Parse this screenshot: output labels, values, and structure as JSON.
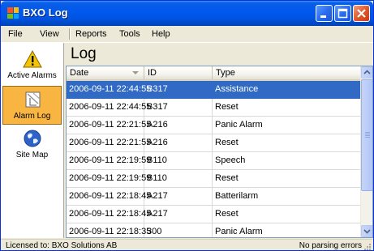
{
  "window": {
    "title": "BXO Log"
  },
  "menu": {
    "items": [
      {
        "label": "File"
      },
      {
        "label": "View"
      },
      {
        "label": "Reports"
      },
      {
        "label": "Tools"
      },
      {
        "label": "Help"
      }
    ]
  },
  "sidebar": {
    "items": [
      {
        "label": "Active Alarms",
        "icon": "warning-icon",
        "selected": false
      },
      {
        "label": "Alarm Log",
        "icon": "log-icon",
        "selected": true
      },
      {
        "label": "Site Map",
        "icon": "globe-icon",
        "selected": false
      }
    ]
  },
  "main": {
    "title": "Log"
  },
  "table": {
    "columns": [
      "Date",
      "ID",
      "Type"
    ],
    "rows": [
      {
        "date": "2006-09-11 22:44:55",
        "id": "B317",
        "type": "Assistance",
        "selected": true
      },
      {
        "date": "2006-09-11 22:44:55",
        "id": "B317",
        "type": "Reset"
      },
      {
        "date": "2006-09-11 22:21:55",
        "id": "A216",
        "type": "Panic Alarm"
      },
      {
        "date": "2006-09-11 22:21:55",
        "id": "A216",
        "type": "Reset"
      },
      {
        "date": "2006-09-11 22:19:59",
        "id": "B110",
        "type": "Speech"
      },
      {
        "date": "2006-09-11 22:19:59",
        "id": "B110",
        "type": "Reset"
      },
      {
        "date": "2006-09-11 22:18:45",
        "id": "A217",
        "type": "Batterilarm"
      },
      {
        "date": "2006-09-11 22:18:45",
        "id": "A217",
        "type": "Reset"
      },
      {
        "date": "2006-09-11 22:18:35",
        "id": "300",
        "type": "Panic Alarm"
      }
    ]
  },
  "status": {
    "left": "Licensed to: BXO Solutions AB",
    "right": "No parsing errors"
  },
  "colors": {
    "titlebar": "#0054e3",
    "selection": "#316ac5",
    "sidebar_selected": "#f9b542"
  }
}
